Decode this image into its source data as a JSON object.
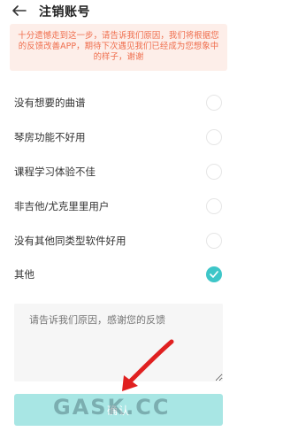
{
  "header": {
    "title": "注销账号",
    "back_icon": "back-arrow-icon"
  },
  "notice": {
    "text": "十分遗憾走到这一步，请告诉我们原因，我们将根据您的反馈改善APP，期待下次遇见我们已经成为您想象中的样子，谢谢"
  },
  "reasons": [
    {
      "label": "没有想要的曲谱",
      "checked": false
    },
    {
      "label": "琴房功能不好用",
      "checked": false
    },
    {
      "label": "课程学习体验不佳",
      "checked": false
    },
    {
      "label": "非吉他/尤克里里用户",
      "checked": false
    },
    {
      "label": "没有其他同类型软件好用",
      "checked": false
    },
    {
      "label": "其他",
      "checked": true
    }
  ],
  "feedback": {
    "placeholder": "请告诉我们原因，感谢您的反馈"
  },
  "confirm": {
    "label": "确认"
  },
  "watermark": {
    "text": "GASK.CC"
  },
  "colors": {
    "accent": "#3ec6c8",
    "button_disabled": "#a8e6e4",
    "notice_bg": "#fdeee9",
    "notice_text": "#ef6d4c",
    "arrow": "#e02020"
  }
}
